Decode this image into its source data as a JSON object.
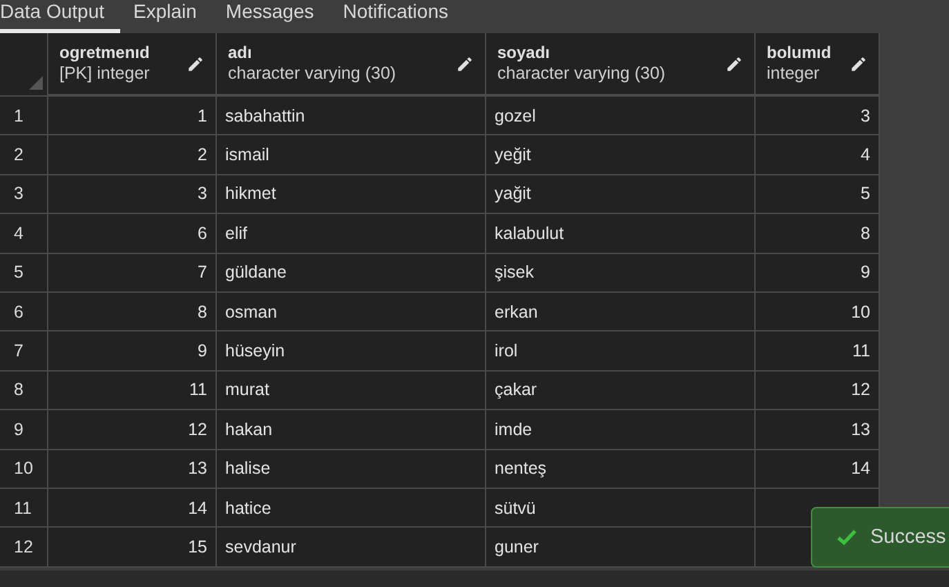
{
  "tabs": [
    {
      "label": "Data Output",
      "selected": true
    },
    {
      "label": "Explain",
      "selected": false
    },
    {
      "label": "Messages",
      "selected": false
    },
    {
      "label": "Notifications",
      "selected": false
    }
  ],
  "table": {
    "columns": [
      {
        "name": "ogretmenıd",
        "type": "[PK] integer"
      },
      {
        "name": "adı",
        "type": "character varying (30)"
      },
      {
        "name": "soyadı",
        "type": "character varying (30)"
      },
      {
        "name": "bolumıd",
        "type": "integer"
      }
    ],
    "rows": [
      {
        "number": "1",
        "cells": [
          "1",
          "sabahattin",
          "gozel",
          "3"
        ]
      },
      {
        "number": "2",
        "cells": [
          "2",
          "ismail",
          "yeğit",
          "4"
        ]
      },
      {
        "number": "3",
        "cells": [
          "3",
          "hikmet",
          "yağit",
          "5"
        ]
      },
      {
        "number": "4",
        "cells": [
          "6",
          "elif",
          "kalabulut",
          "8"
        ]
      },
      {
        "number": "5",
        "cells": [
          "7",
          "güldane",
          "şisek",
          "9"
        ]
      },
      {
        "number": "6",
        "cells": [
          "8",
          "osman",
          "erkan",
          "10"
        ]
      },
      {
        "number": "7",
        "cells": [
          "9",
          "hüseyin",
          "irol",
          "11"
        ]
      },
      {
        "number": "8",
        "cells": [
          "11",
          "murat",
          "çakar",
          "12"
        ]
      },
      {
        "number": "9",
        "cells": [
          "12",
          "hakan",
          "imde",
          "13"
        ]
      },
      {
        "number": "10",
        "cells": [
          "13",
          "halise",
          "nenteş",
          "14"
        ]
      },
      {
        "number": "11",
        "cells": [
          "14",
          "hatice",
          "sütvü",
          null
        ]
      },
      {
        "number": "12",
        "cells": [
          "15",
          "sevdanur",
          "guner",
          null
        ]
      }
    ]
  },
  "toast": {
    "message": "Success"
  }
}
